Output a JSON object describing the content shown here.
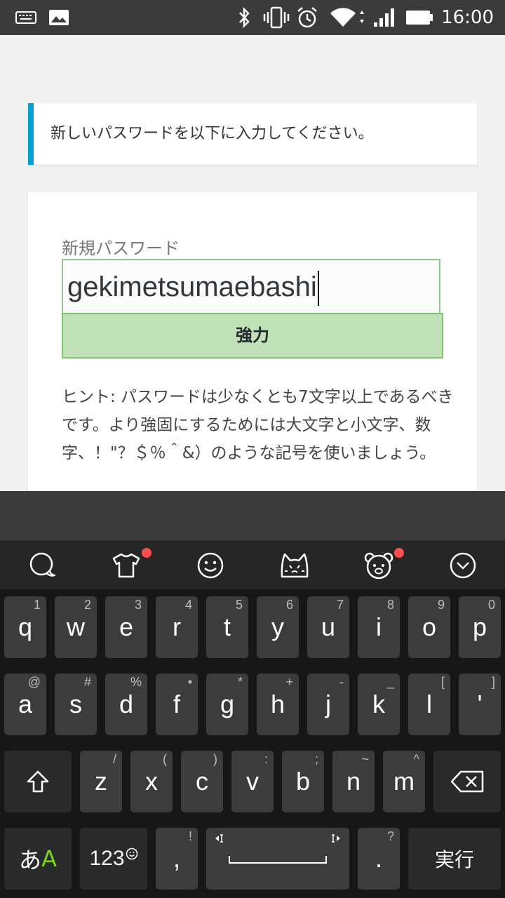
{
  "status_bar": {
    "time": "16:00",
    "icons": [
      "keyboard-icon",
      "image-icon",
      "bluetooth-icon",
      "vibrate-icon",
      "alarm-icon",
      "wifi-icon",
      "signal-icon",
      "battery-icon"
    ]
  },
  "notice": {
    "text": "新しいパスワードを以下に入力してください。",
    "accent_color": "#00a0d2"
  },
  "form": {
    "label": "新規パスワード",
    "password_value": "gekimetsumaebashi",
    "strength_label": "強力",
    "strength_color": "#c1e1b9",
    "hint": "ヒント: パスワードは少なくとも7文字以上であるべきです。より強固にするためには大文字と小文字、数字、！\"？＄％＾&）のような記号を使いましょう。"
  },
  "keyboard": {
    "toolbar": [
      {
        "icon": "search-icon",
        "badge": false
      },
      {
        "icon": "tshirt-icon",
        "badge": true
      },
      {
        "icon": "smiley-icon",
        "badge": false
      },
      {
        "icon": "cat-face-icon",
        "badge": false
      },
      {
        "icon": "bear-face-icon",
        "badge": true
      },
      {
        "icon": "chevron-down-icon",
        "badge": false
      }
    ],
    "row1": [
      {
        "main": "q",
        "sub": "1"
      },
      {
        "main": "w",
        "sub": "2"
      },
      {
        "main": "e",
        "sub": "3"
      },
      {
        "main": "r",
        "sub": "4"
      },
      {
        "main": "t",
        "sub": "5"
      },
      {
        "main": "y",
        "sub": "6"
      },
      {
        "main": "u",
        "sub": "7"
      },
      {
        "main": "i",
        "sub": "8"
      },
      {
        "main": "o",
        "sub": "9"
      },
      {
        "main": "p",
        "sub": "0"
      }
    ],
    "row2": [
      {
        "main": "a",
        "sub": "@"
      },
      {
        "main": "s",
        "sub": "#"
      },
      {
        "main": "d",
        "sub": "%"
      },
      {
        "main": "f",
        "sub": "•"
      },
      {
        "main": "g",
        "sub": "*"
      },
      {
        "main": "h",
        "sub": "+"
      },
      {
        "main": "j",
        "sub": "-"
      },
      {
        "main": "k",
        "sub": "_"
      },
      {
        "main": "l",
        "sub": "["
      },
      {
        "main": "'",
        "sub": "]"
      }
    ],
    "row3": [
      {
        "main": "z",
        "sub": "/"
      },
      {
        "main": "x",
        "sub": "("
      },
      {
        "main": "c",
        "sub": ")"
      },
      {
        "main": "v",
        "sub": ":"
      },
      {
        "main": "b",
        "sub": ";"
      },
      {
        "main": "n",
        "sub": "~"
      },
      {
        "main": "m",
        "sub": "^"
      }
    ],
    "bottom": {
      "lang_part1": "あ",
      "lang_part2": "A",
      "numbers": "123",
      "comma": ",",
      "comma_sub": "!",
      "period": ".",
      "period_sub": "?",
      "enter": "実行"
    }
  }
}
